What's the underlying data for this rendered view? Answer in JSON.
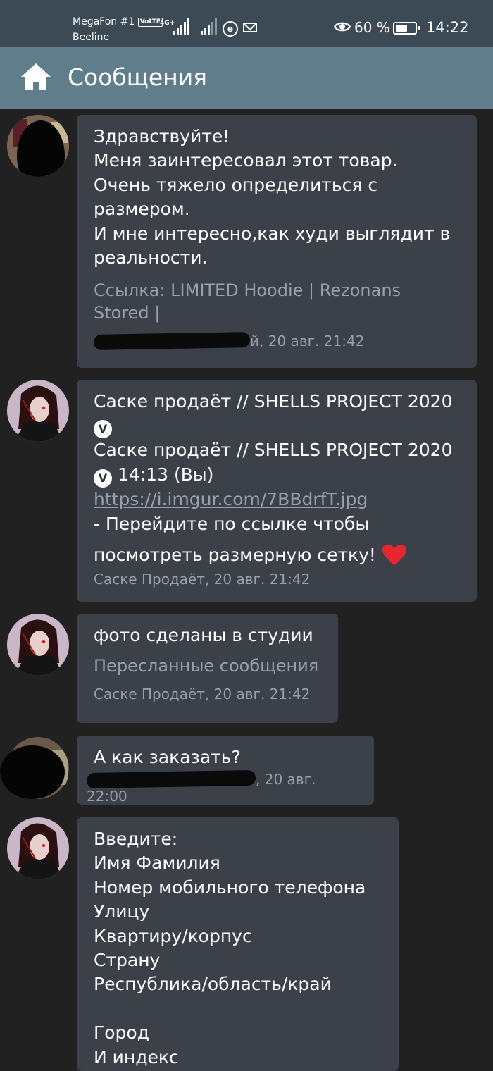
{
  "status_bar": {
    "carrier1": "MegaFon #1",
    "volte": "VoLTE",
    "net_type": "4G+",
    "carrier2": "Beeline",
    "battery_pct": "60 %",
    "battery_level": 0.6,
    "time": "14:22",
    "icons": [
      "signal-icon",
      "e-icon",
      "mail-icon",
      "eye-icon",
      "battery-icon"
    ]
  },
  "app_bar": {
    "title": "Сообщения",
    "icon": "home-icon"
  },
  "messages": [
    {
      "text": "Здравствуйте!\nМеня заинтересовал этот товар.\nОчень тяжело определиться с размером.\nИ мне интересно,как худи выглядит в реальности.",
      "attachment": "Ссылка: LIMITED Hoodie | Rezonans Stored |",
      "sender_suffix": "й",
      "datetime": ", 20 авг. 21:42"
    },
    {
      "title": "Саске продаёт // SHELLS PROJECT 2020",
      "title2": "Саске продаёт // SHELLS PROJECT 2020",
      "badge": "V",
      "time_you": " 14:13 (Вы)",
      "link": "https://i.imgur.com/7BBdrfT.jpg",
      "text": "- Перейдите по ссылке чтобы посмотреть размерную сетку!",
      "sender": "Саске Продаёт",
      "datetime": ", 20 авг. 21:42"
    },
    {
      "text": "фото сделаны в студии",
      "attachment": "Пересланные сообщения",
      "sender": "Саске Продаёт",
      "datetime": ", 20 авг. 21:42"
    },
    {
      "text": "А как заказать?",
      "datetime": ", 20 авг. 22:00"
    },
    {
      "text": "Введите:\nИмя Фамилия\nНомер мобильного телефона\nУлицу\nКвартиру/корпус\nСтрану\nРеспублика/область/край\n\nГород\nИ индекс"
    }
  ]
}
